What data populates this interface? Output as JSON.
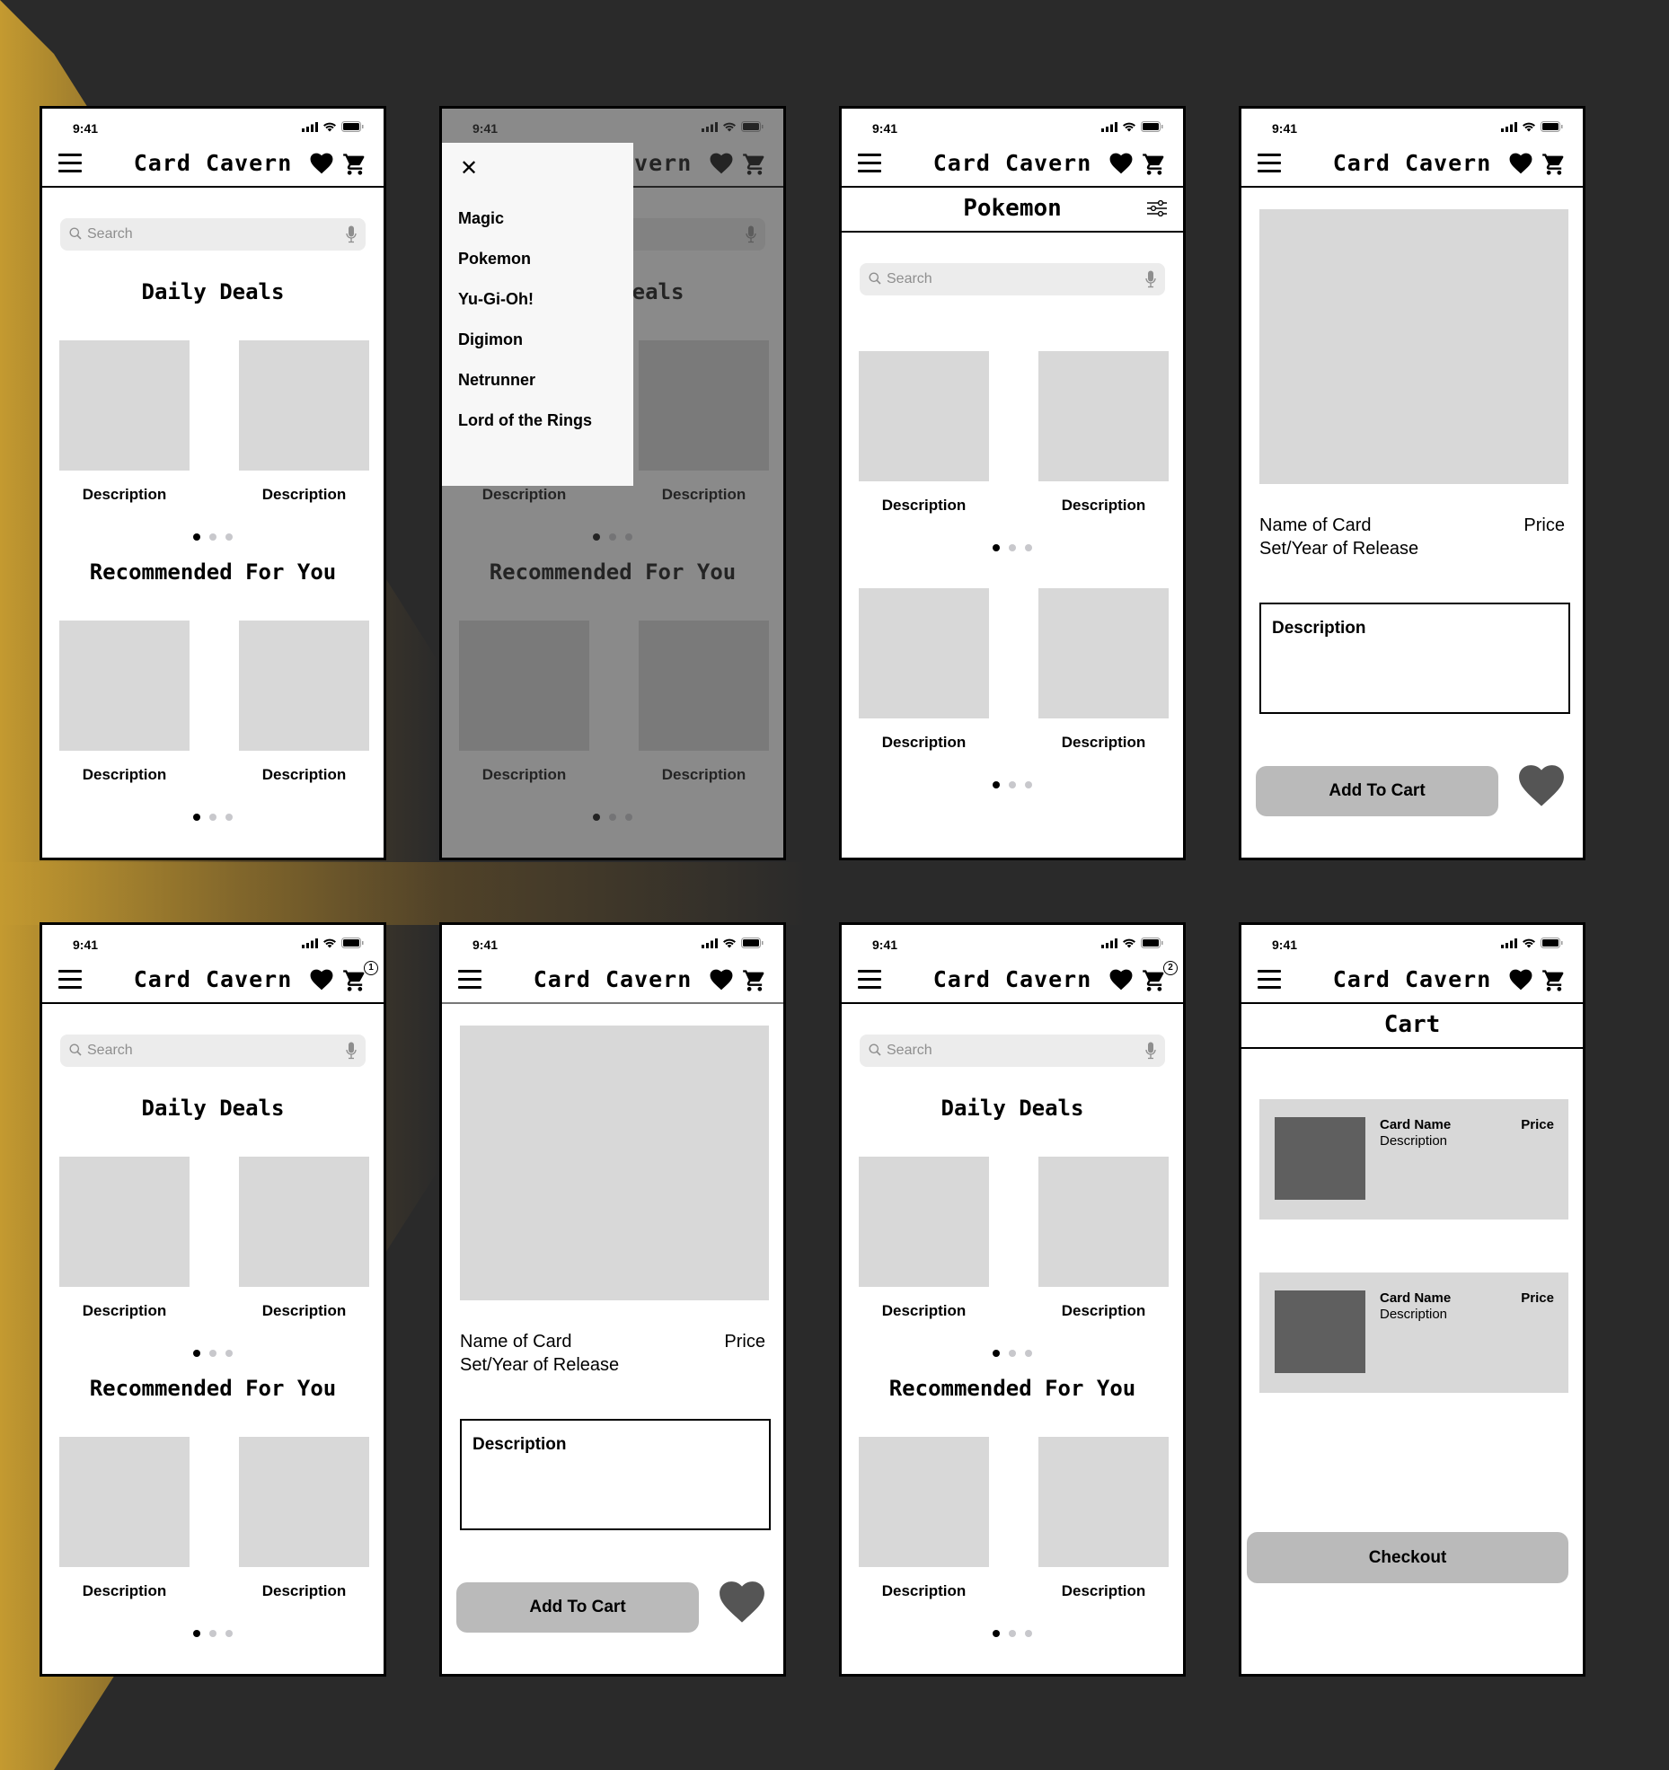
{
  "colors": {
    "background": "#2a2a2a",
    "accent_gold": "#c49a30",
    "placeholder": "#d8d8d8",
    "button_grey": "#bababa",
    "thumb_dark": "#5f5f5f"
  },
  "common": {
    "time": "9:41",
    "app_title": "Card Cavern",
    "search_placeholder": "Search",
    "tile_label": "Description",
    "icons": {
      "menu": "hamburger-menu-icon",
      "favorite": "heart-icon",
      "cart": "cart-icon",
      "search": "search-icon",
      "mic": "microphone-icon",
      "close": "close-icon",
      "filter": "filter-sliders-icon",
      "signal": "signal-icon",
      "wifi": "wifi-icon",
      "battery": "battery-icon"
    }
  },
  "screens": [
    {
      "id": "home",
      "cart_badge": null,
      "sections": [
        {
          "title": "Daily Deals",
          "items": [
            "Description",
            "Description"
          ],
          "active_dot": 1,
          "dot_count": 3
        },
        {
          "title": "Recommended For You",
          "items": [
            "Description",
            "Description"
          ],
          "active_dot": 1,
          "dot_count": 3
        }
      ]
    },
    {
      "id": "home-menu-open",
      "menu": {
        "close_label": "×",
        "items": [
          "Magic",
          "Pokemon",
          "Yu-Gi-Oh!",
          "Digimon",
          "Netrunner",
          "Lord of the Rings"
        ]
      },
      "sections": [
        {
          "title": "Daily Deals",
          "items": [
            "Description",
            "Description"
          ]
        },
        {
          "title": "Recommended For You",
          "items": [
            "Description",
            "Description"
          ]
        }
      ]
    },
    {
      "id": "category",
      "category_title": "Pokemon",
      "rows": [
        {
          "items": [
            "Description",
            "Description"
          ],
          "active_dot": 1,
          "dot_count": 3
        },
        {
          "items": [
            "Description",
            "Description"
          ],
          "active_dot": 1,
          "dot_count": 3
        }
      ]
    },
    {
      "id": "card-detail",
      "name": "Name of Card",
      "set": "Set/Year of Release",
      "price": "Price",
      "description": "Description",
      "add_to_cart": "Add To Cart"
    },
    {
      "id": "home-cart-1",
      "cart_badge": "1",
      "sections": [
        {
          "title": "Daily Deals",
          "items": [
            "Description",
            "Description"
          ]
        },
        {
          "title": "Recommended For You",
          "items": [
            "Description",
            "Description"
          ]
        }
      ]
    },
    {
      "id": "card-detail-2",
      "name": "Name of Card",
      "set": "Set/Year of Release",
      "price": "Price",
      "description": "Description",
      "add_to_cart": "Add To Cart"
    },
    {
      "id": "home-cart-2",
      "cart_badge": "2",
      "sections": [
        {
          "title": "Daily Deals",
          "items": [
            "Description",
            "Description"
          ]
        },
        {
          "title": "Recommended For You",
          "items": [
            "Description",
            "Description"
          ]
        }
      ]
    },
    {
      "id": "cart",
      "title": "Cart",
      "items": [
        {
          "name": "Card Name",
          "description": "Description",
          "price": "Price"
        },
        {
          "name": "Card Name",
          "description": "Description",
          "price": "Price"
        }
      ],
      "checkout": "Checkout"
    }
  ]
}
